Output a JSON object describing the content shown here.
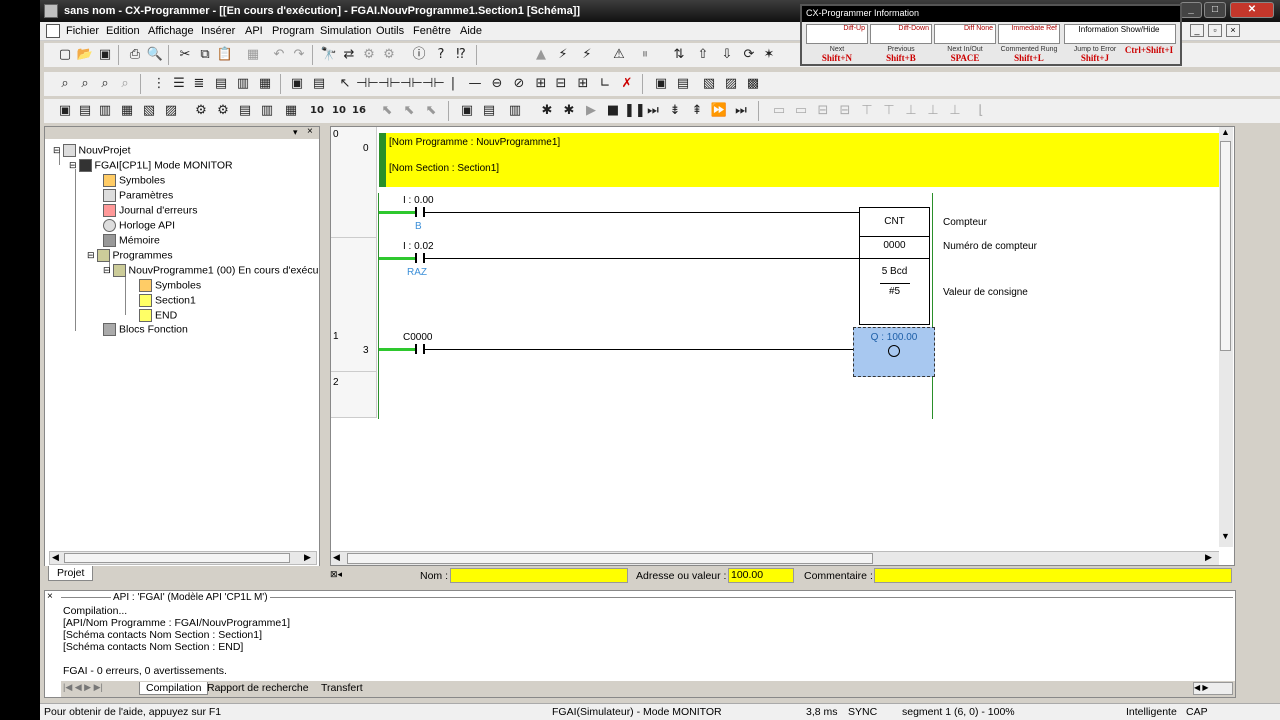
{
  "window": {
    "title": "sans nom - CX-Programmer - [[En cours d'exécution] - FGAI.NouvProgramme1.Section1 [Schéma]]"
  },
  "menu": [
    "Fichier",
    "Edition",
    "Affichage",
    "Insérer",
    "API",
    "Program",
    "Simulation",
    "Outils",
    "Fenêtre",
    "Aide"
  ],
  "info_panel": {
    "title": "CX-Programmer Information",
    "cells": [
      "Diff-Up",
      "Diff-Down",
      "Diff None",
      "Immediate Ref",
      "Information Show/Hide"
    ],
    "labels": [
      {
        "top": "Next",
        "key": "Shift+N"
      },
      {
        "top": "Previous",
        "key": "Shift+B"
      },
      {
        "top": "Next In/Out",
        "key": "SPACE"
      },
      {
        "top": "Commented Rung",
        "key": "Shift+L"
      },
      {
        "top": "Jump to Error",
        "key": "Shift+J"
      },
      {
        "top": "",
        "key": "Ctrl+Shift+I"
      }
    ]
  },
  "tree": {
    "items": [
      {
        "label": "NouvProjet",
        "icon": "project-icon"
      },
      {
        "label": "FGAI[CP1L] Mode MONITOR",
        "icon": "plc-icon"
      },
      {
        "label": "Symboles",
        "icon": "symbols-icon"
      },
      {
        "label": "Paramètres",
        "icon": "settings-icon"
      },
      {
        "label": "Journal d'erreurs",
        "icon": "error-log-icon"
      },
      {
        "label": "Horloge API",
        "icon": "clock-icon"
      },
      {
        "label": "Mémoire",
        "icon": "memory-icon"
      },
      {
        "label": "Programmes",
        "icon": "programs-icon"
      },
      {
        "label": "NouvProgramme1 (00) En cours d'exécu",
        "icon": "program-icon"
      },
      {
        "label": "Symboles",
        "icon": "symbols-icon"
      },
      {
        "label": "Section1",
        "icon": "section-icon"
      },
      {
        "label": "END",
        "icon": "section-icon"
      },
      {
        "label": "Blocs Fonction",
        "icon": "function-block-icon"
      }
    ],
    "tab": "Projet"
  },
  "ladder": {
    "header_row_num": "0",
    "header_step": "0",
    "prog_name": "[Nom Programme : NouvProgramme1]",
    "section_name": "[Nom Section : Section1]",
    "rung0": {
      "contact1_addr": "I : 0.00",
      "contact1_sym": "B",
      "contact2_addr": "I : 0.02",
      "contact2_sym": "RAZ",
      "block_name": "CNT",
      "block_num": "0000",
      "block_val": "5 Bcd",
      "block_set": "#5",
      "cmt1": "Compteur",
      "cmt2": "Numéro de compteur",
      "cmt3": "Valeur de consigne"
    },
    "rung1": {
      "num": "1",
      "step": "3",
      "contact_addr": "C0000",
      "coil_addr": "Q : 100.00"
    },
    "rung2_num": "2"
  },
  "fieldbar": {
    "name_label": "Nom :",
    "address_label": "Adresse ou valeur :",
    "address_value": "100.00",
    "comment_label": "Commentaire :"
  },
  "output": {
    "header": "API : 'FGAI' (Modèle API 'CP1L M')",
    "lines": [
      "Compilation...",
      "[API/Nom Programme : FGAI/NouvProgramme1]",
      "[Schéma contacts Nom Section : Section1]",
      "[Schéma contacts Nom Section : END]",
      "",
      "FGAI - 0 erreurs, 0 avertissements."
    ],
    "tabs": [
      "Compilation",
      "Rapport de recherche",
      "Transfert"
    ]
  },
  "status": {
    "help": "Pour obtenir de l'aide, appuyez sur F1",
    "mode": "FGAI(Simulateur) - Mode MONITOR",
    "cycle": "3,8 ms",
    "sync": "SYNC",
    "segment": "segment 1 (6, 0)  - 100%",
    "smart": "Intelligente",
    "caps": "CAP"
  }
}
